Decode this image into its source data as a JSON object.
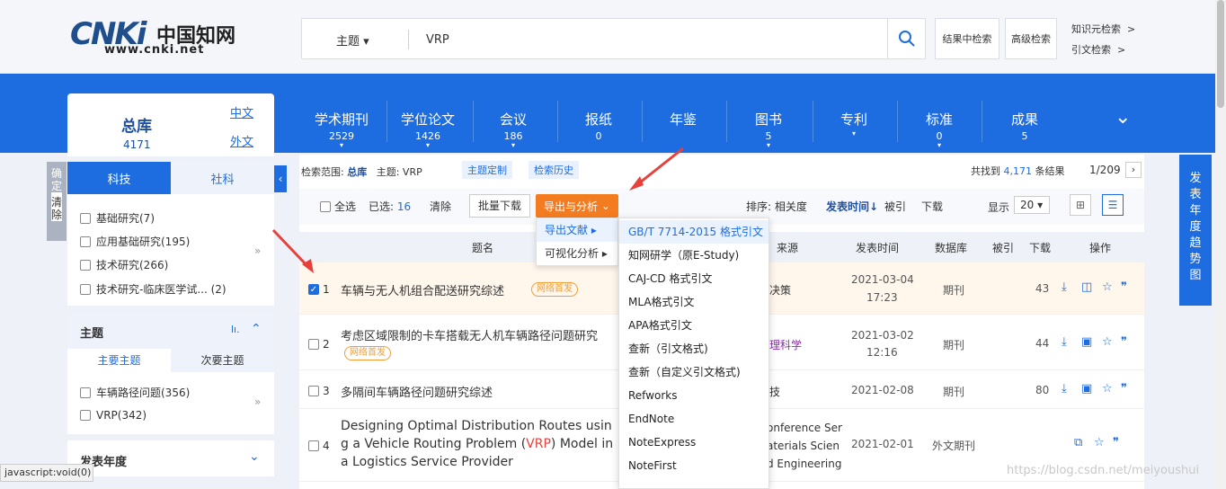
{
  "header": {
    "logo_url": "www.cnki.net",
    "logo_cn": "中国知网",
    "logo_mark": "CNKi",
    "search_scope": "主题",
    "search_value": "VRP",
    "btn_in_results": "结果中检索",
    "btn_advanced": "高级检索",
    "link_knowledge": "知识元检索",
    "link_citation": "引文检索",
    "chev": ">"
  },
  "categories": [
    {
      "name": "学术期刊",
      "count": "2529"
    },
    {
      "name": "学位论文",
      "count": "1426"
    },
    {
      "name": "会议",
      "count": "186"
    },
    {
      "name": "报纸",
      "count": "0"
    },
    {
      "name": "年鉴",
      "count": ""
    },
    {
      "name": "图书",
      "count": "5"
    },
    {
      "name": "专利",
      "count": ""
    },
    {
      "name": "标准",
      "count": "0"
    },
    {
      "name": "成果",
      "count": "5"
    }
  ],
  "zongku": {
    "label": "总库",
    "count": "4171",
    "zh": "中文",
    "wai": "外文"
  },
  "leftpanel": {
    "tab1": "科技",
    "tab2": "社科",
    "items": [
      "基础研究(7)",
      "应用基础研究(195)",
      "技术研究(266)",
      "技术研究-临床医学试... (2)"
    ],
    "more": "»"
  },
  "confirm": {
    "ok": "确定",
    "clear": "清除"
  },
  "theme": {
    "title": "主题",
    "tab1": "主要主题",
    "tab2": "次要主题",
    "items": [
      "车辆路径问题(356)",
      "VRP(342)"
    ]
  },
  "year": {
    "title": "发表年度"
  },
  "scope": {
    "label": "检索范围:",
    "lib": "总库",
    "topic": "主题: VRP",
    "custom": "主题定制",
    "history": "检索历史",
    "found_pre": "共找到",
    "found": "4,171",
    "found_post": "条结果",
    "page": "1/209"
  },
  "toolbar": {
    "selectall": "全选",
    "selected": "已选:",
    "selected_n": "16",
    "clear": "清除",
    "batch": "批量下载",
    "export": "导出与分析",
    "sort": "排序:",
    "relevance": "相关度",
    "pubtime": "发表时间",
    "cited": "被引",
    "dl": "下载",
    "show": "显示",
    "per": "20"
  },
  "menu1": [
    "导出文献",
    "可视化分析"
  ],
  "menu2": [
    "GB/T 7714-2015 格式引文",
    "知网研学（原E-Study)",
    "CAJ-CD 格式引文",
    "MLA格式引文",
    "APA格式引文",
    "查新（引文格式)",
    "查新（自定义引文格式)",
    "Refworks",
    "EndNote",
    "NoteExpress",
    "NoteFirst"
  ],
  "thead": {
    "title": "题名",
    "source": "来源",
    "time": "发表时间",
    "db": "数据库",
    "cited": "被引",
    "dl": "下载",
    "op": "操作"
  },
  "rows": [
    {
      "n": "1",
      "title": "车辆与无人机组合配送研究综述",
      "badge": "网络首发",
      "source": "决策",
      "date": "2021-03-04",
      "time": "17:23",
      "db": "期刊",
      "dl": "43"
    },
    {
      "n": "2",
      "title": "考虑区域限制的卡车搭载无人机车辆路径问题研究",
      "badge": "网络首发",
      "source": "理科学",
      "date": "2021-03-02",
      "time": "12:16",
      "db": "期刊",
      "dl": "44"
    },
    {
      "n": "3",
      "title": "多隔间车辆路径问题研究综述",
      "badge": "",
      "source": "技",
      "date": "2021-02-08",
      "time": "",
      "db": "期刊",
      "dl": "80"
    },
    {
      "n": "4",
      "t1": "Designing Optimal Distribution Routes usin",
      "t2a": "g a Vehicle Routing Problem (",
      "t2b": "VRP",
      "t2c": ") Model in",
      "t3": "a Logistics Service Provider",
      "s1": "onference Ser",
      "s2": "aterials Scien",
      "s3": "d Engineering",
      "date": "2021-02-01",
      "db": "外文期刊"
    }
  ],
  "righttab": "发表年度趋势图",
  "status": "javascript:void(0)",
  "watermark": "https://blog.csdn.net/meiyoushui",
  "colors": {
    "blue": "#1e6de0",
    "orange": "#f47c20",
    "red": "#e8403a"
  }
}
